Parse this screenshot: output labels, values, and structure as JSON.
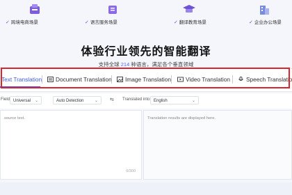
{
  "scenarios": [
    {
      "label": "跨境电商场景",
      "icon": "ecommerce-icon"
    },
    {
      "label": "语言服务场景",
      "icon": "language-service-icon"
    },
    {
      "label": "翻译教育场景",
      "icon": "education-icon"
    },
    {
      "label": "企业办公场景",
      "icon": "office-icon"
    }
  ],
  "hero": {
    "title": "体验行业领先的智能翻译",
    "subtitle_pre": "支持全球 ",
    "subtitle_num": "214",
    "subtitle_post": " 种语言，满足各个垂直领域"
  },
  "tabs": [
    {
      "label": "Text Translation",
      "icon": "text-icon",
      "active": true
    },
    {
      "label": "Document Translation",
      "icon": "document-icon"
    },
    {
      "label": "Image Translation",
      "icon": "image-icon"
    },
    {
      "label": "Video Translation",
      "icon": "video-icon"
    },
    {
      "label": "Speech Translation",
      "icon": "microphone-icon"
    }
  ],
  "options": {
    "field_label": "Field",
    "field_value": "Universal",
    "source_value": "Auto Detection",
    "swap_symbol": "⇆",
    "target_label": "Translated into:",
    "target_value": "English"
  },
  "source_panel": {
    "placeholder": "source text.",
    "counter": "0/300"
  },
  "result_panel": {
    "placeholder": "Translation results are displayed here."
  },
  "colors": {
    "accent": "#3b5bdb",
    "highlight": "#d9262d",
    "check": "#6a4bd8"
  }
}
